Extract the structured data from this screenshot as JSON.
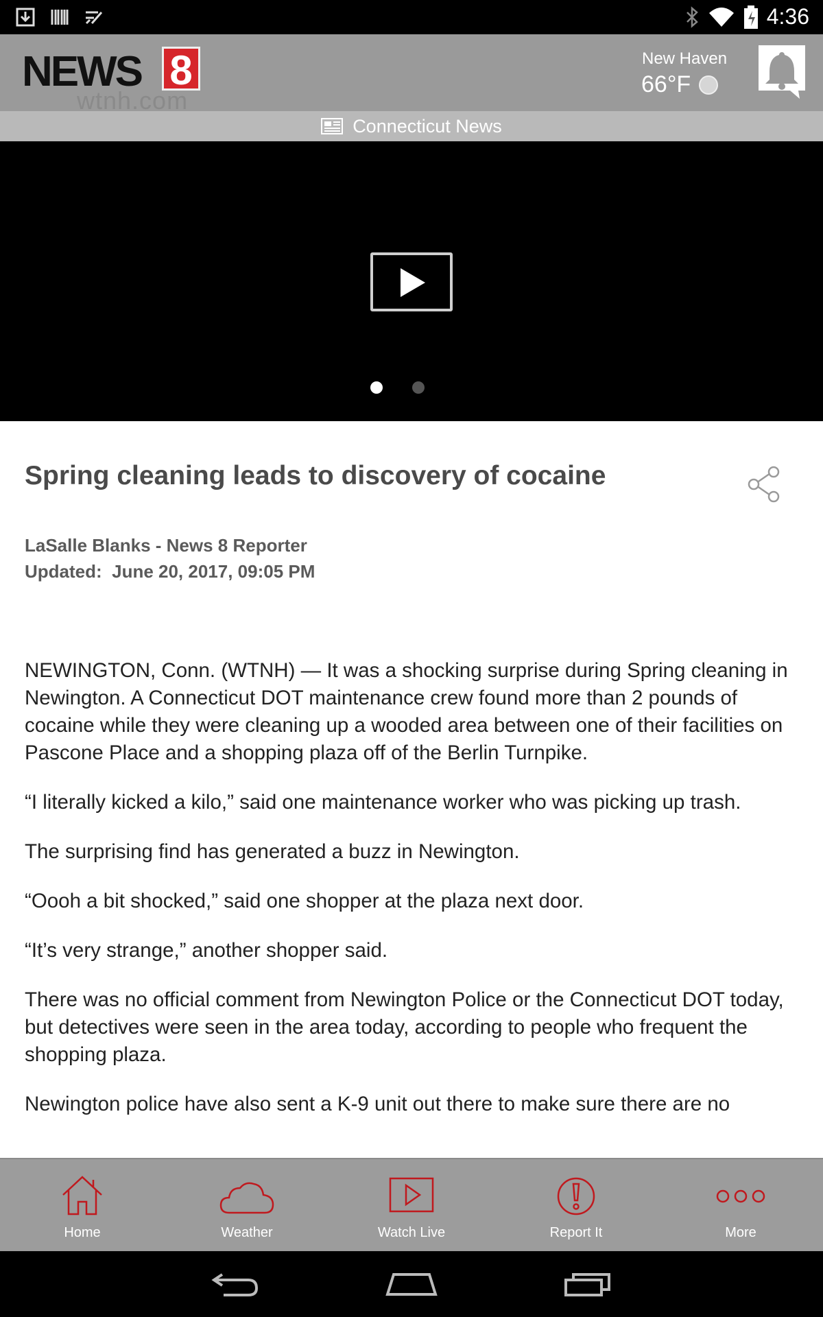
{
  "status_bar": {
    "time": "4:36",
    "left_icons": [
      "download-icon",
      "barcode-icon",
      "checklist-icon"
    ],
    "right_icons": [
      "bluetooth-icon",
      "wifi-icon",
      "battery-icon"
    ]
  },
  "header": {
    "logo_text": "NEWS",
    "logo_number": "8",
    "logo_sub": "wtnh.com",
    "weather_location": "New Haven",
    "weather_temp": "66°F",
    "notification_icon": "bell-icon"
  },
  "section": {
    "label": "Connecticut News",
    "icon": "newspaper-icon"
  },
  "video": {
    "play_icon": "play-icon",
    "slide_count": 2,
    "active_slide": 1
  },
  "article": {
    "title": "Spring cleaning leads to discovery of cocaine",
    "author": "LaSalle Blanks - News 8 Reporter",
    "updated": "Updated:  June 20, 2017, 09:05 PM",
    "paragraphs": [
      "NEWINGTON, Conn. (WTNH) — It was a shocking surprise during Spring cleaning in Newington. A Connecticut DOT maintenance crew found more than 2 pounds of cocaine while they were cleaning up a wooded area between one of their facilities on Pascone Place and a shopping plaza off of the Berlin Turnpike.",
      "“I literally kicked a kilo,” said one maintenance worker who was picking up trash.",
      "The surprising find has generated a buzz in Newington.",
      "“Oooh a bit shocked,” said one shopper at the plaza next door.",
      "“It’s very strange,” another shopper said.",
      "There was no official comment from Newington Police or the Connecticut DOT today, but detectives were seen in the area today, according to people who frequent the shopping plaza.",
      "Newington police have also sent a K-9 unit out there to make sure there are no"
    ]
  },
  "bottom_nav": {
    "items": [
      {
        "label": "Home",
        "icon": "home-icon"
      },
      {
        "label": "Weather",
        "icon": "cloud-icon"
      },
      {
        "label": "Watch Live",
        "icon": "play-icon"
      },
      {
        "label": "Report It",
        "icon": "alert-icon"
      },
      {
        "label": "More",
        "icon": "more-icon"
      }
    ]
  },
  "colors": {
    "accent": "#c0191e",
    "header_bg": "#9a9a9a",
    "section_bg": "#b9b9b9",
    "nav_bg": "#9c9c9c"
  }
}
